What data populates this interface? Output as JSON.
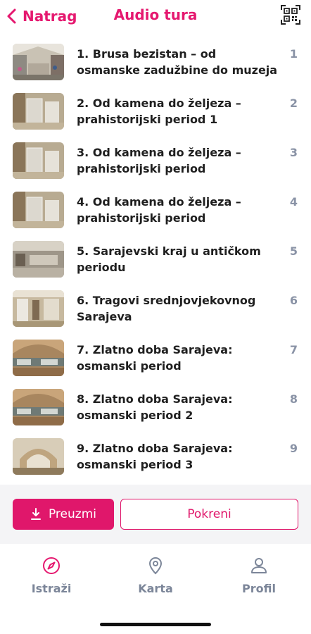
{
  "header": {
    "back_label": "Natrag",
    "title": "Audio tura",
    "accent_color": "#e5186f"
  },
  "tour_items": [
    {
      "title": "1. Brusa bezistan – od osmanske zadužbine do muzeja",
      "number": "1"
    },
    {
      "title": "2. Od kamena do željeza – prahistorijski period 1",
      "number": "2"
    },
    {
      "title": "3. Od kamena do željeza – prahistorijski period",
      "number": "3"
    },
    {
      "title": "4. Od kamena do željeza – prahistorijski period",
      "number": "4"
    },
    {
      "title": "5. Sarajevski kraj u antičkom periodu",
      "number": "5"
    },
    {
      "title": "6. Tragovi srednjovjekovnog Sarajeva",
      "number": "6"
    },
    {
      "title": "7. Zlatno doba Sarajeva: osmanski period",
      "number": "7"
    },
    {
      "title": "8. Zlatno doba Sarajeva: osmanski period 2",
      "number": "8"
    },
    {
      "title": "9. Zlatno doba Sarajeva: osmanski period 3",
      "number": "9"
    }
  ],
  "actions": {
    "download_label": "Preuzmi",
    "start_label": "Pokreni"
  },
  "tabs": [
    {
      "label": "Istraži",
      "icon": "compass-icon"
    },
    {
      "label": "Karta",
      "icon": "map-pin-icon"
    },
    {
      "label": "Profil",
      "icon": "user-icon"
    }
  ]
}
